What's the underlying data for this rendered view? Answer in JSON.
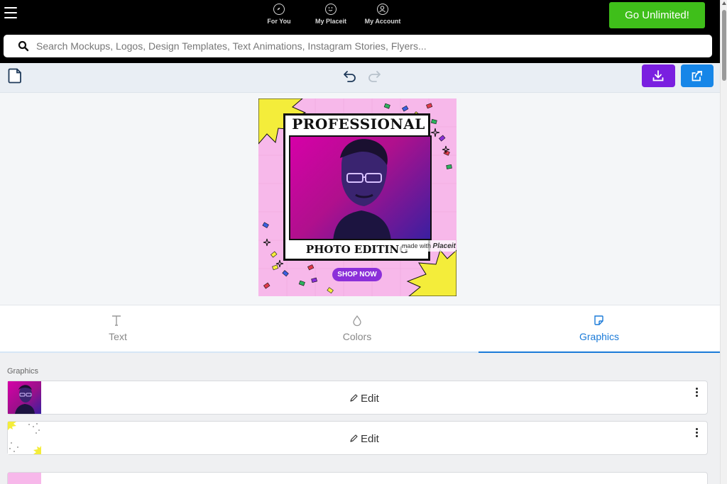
{
  "topbar": {
    "nav": [
      {
        "label": "For You",
        "icon": "compass-icon"
      },
      {
        "label": "My Placeit",
        "icon": "smiley-icon"
      },
      {
        "label": "My Account",
        "icon": "account-icon"
      }
    ],
    "cta_label": "Go Unlimited!",
    "cta_color": "#3fbf1a"
  },
  "search": {
    "placeholder": "Search Mockups, Logos, Design Templates, Text Animations, Instagram Stories, Flyers..."
  },
  "toolbar": {
    "download_color": "#7a1fe0",
    "share_color": "#1686e8"
  },
  "design": {
    "headline_top": "PROFESSIONAL",
    "headline_bottom": "PHOTO EDITING",
    "cta": "SHOP NOW",
    "watermark_prefix": "made with",
    "watermark_brand": "Placeit",
    "background_color": "#f7b8ea"
  },
  "tabs": [
    {
      "label": "Text",
      "icon": "text-icon"
    },
    {
      "label": "Colors",
      "icon": "drop-icon"
    },
    {
      "label": "Graphics",
      "icon": "sticker-icon",
      "active": true
    }
  ],
  "graphics_panel": {
    "title": "Graphics",
    "items": [
      {
        "action": "Edit",
        "thumb": "portrait-thumbnail"
      },
      {
        "action": "Edit",
        "thumb": "confetti-thumbnail"
      }
    ]
  }
}
